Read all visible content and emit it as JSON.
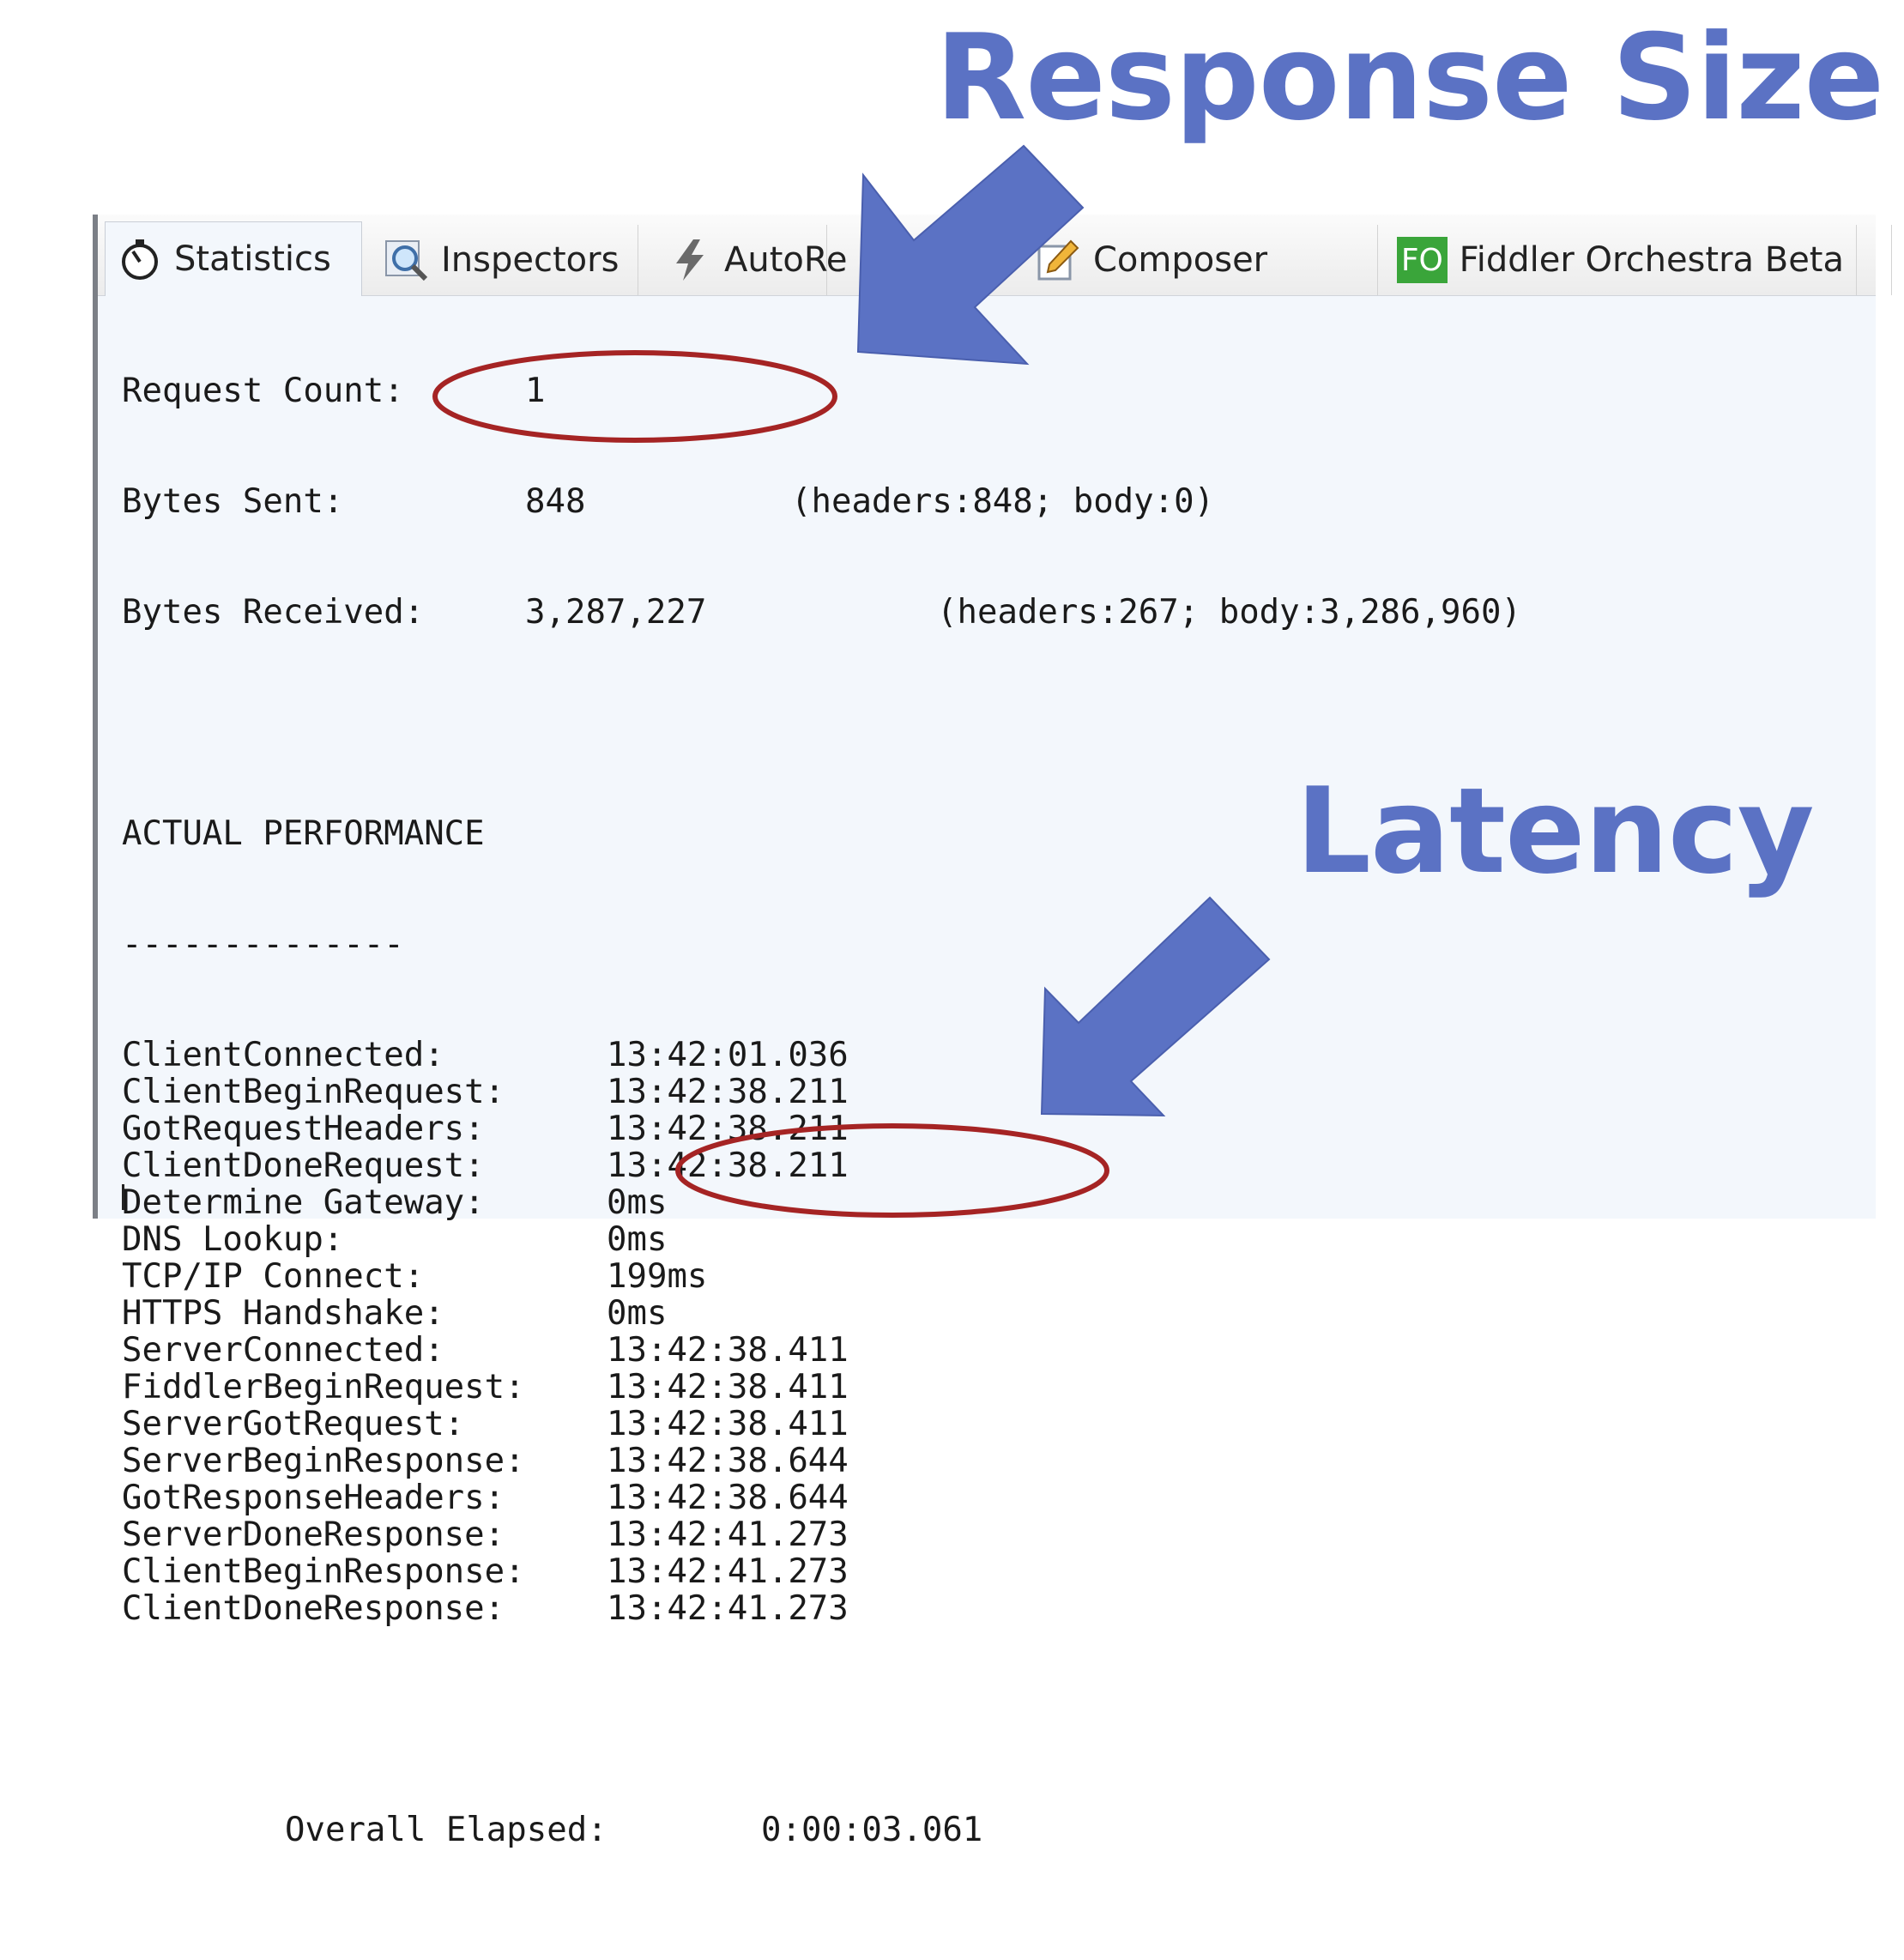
{
  "callouts": {
    "response_size": "Response Size",
    "latency": "Latency"
  },
  "tabs": [
    {
      "label": "Statistics",
      "icon": "stopwatch-icon",
      "active": true
    },
    {
      "label": "Inspectors",
      "icon": "magnifier-icon",
      "active": false
    },
    {
      "label": "AutoRe",
      "icon": "lightning-icon",
      "active": false
    },
    {
      "label": "Composer",
      "icon": "pencil-icon",
      "active": false
    },
    {
      "label": "Fiddler Orchestra Beta",
      "icon": "fo-badge-icon",
      "active": false,
      "badge": "FO"
    },
    {
      "label": "",
      "icon": "fiddlerscript-icon",
      "active": false
    }
  ],
  "summary": {
    "request_count_label": "Request Count:",
    "request_count": "1",
    "bytes_sent_label": "Bytes Sent:",
    "bytes_sent": "848",
    "bytes_sent_detail": "(headers:848; body:0)",
    "bytes_received_label": "Bytes Received:",
    "bytes_received": "3,287,227",
    "bytes_received_detail": "(headers:267; body:3,286,960)"
  },
  "performance": {
    "heading": "ACTUAL PERFORMANCE",
    "divider": "--------------",
    "rows": [
      {
        "label": "ClientConnected:",
        "value": "13:42:01.036"
      },
      {
        "label": "ClientBeginRequest:",
        "value": "13:42:38.211"
      },
      {
        "label": "GotRequestHeaders:",
        "value": "13:42:38.211"
      },
      {
        "label": "ClientDoneRequest:",
        "value": "13:42:38.211"
      },
      {
        "label": "Determine Gateway:",
        "value": "0ms"
      },
      {
        "label": "DNS Lookup:",
        "value": "0ms"
      },
      {
        "label": "TCP/IP Connect:",
        "value": "199ms"
      },
      {
        "label": "HTTPS Handshake:",
        "value": "0ms"
      },
      {
        "label": "ServerConnected:",
        "value": "13:42:38.411"
      },
      {
        "label": "FiddlerBeginRequest:",
        "value": "13:42:38.411"
      },
      {
        "label": "ServerGotRequest:",
        "value": "13:42:38.411"
      },
      {
        "label": "ServerBeginResponse:",
        "value": "13:42:38.644"
      },
      {
        "label": "GotResponseHeaders:",
        "value": "13:42:38.644"
      },
      {
        "label": "ServerDoneResponse:",
        "value": "13:42:41.273"
      },
      {
        "label": "ClientBeginResponse:",
        "value": "13:42:41.273"
      },
      {
        "label": "ClientDoneResponse:",
        "value": "13:42:41.273"
      }
    ],
    "overall_label": "Overall Elapsed:",
    "overall_value": "0:00:03.061"
  },
  "colors": {
    "callout_blue": "#5b72c4",
    "ellipse_red": "#a52424",
    "panel_bg": "#f3f7fc",
    "fo_badge": "#3aa53a"
  }
}
